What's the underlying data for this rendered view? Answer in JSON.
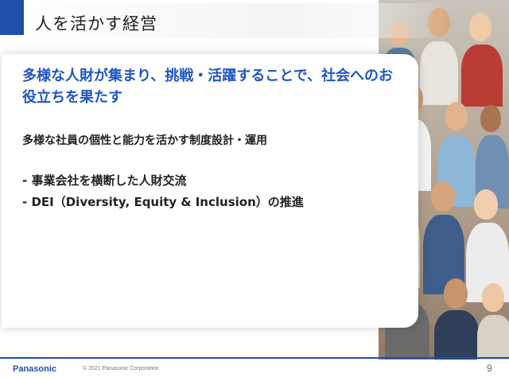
{
  "slide": {
    "title": "人を活かす経営",
    "headline": "多様な人財が集まり、挑戦・活躍することで、社会へのお役立ちを果たす",
    "subheading": "多様な社員の個性と能力を活かす制度設計・運用",
    "bullets": [
      "- 事業会社を横断した人財交流",
      "- DEI（Diversity, Equity & Inclusion）の推進"
    ]
  },
  "footer": {
    "logo": "Panasonic",
    "copyright": "© 2021 Panasonic Corporation",
    "page_number": "9"
  },
  "colors": {
    "brand_blue": "#1f4fa8",
    "headline_blue": "#1f57c4"
  },
  "image": {
    "icon": "crowd-photo"
  }
}
